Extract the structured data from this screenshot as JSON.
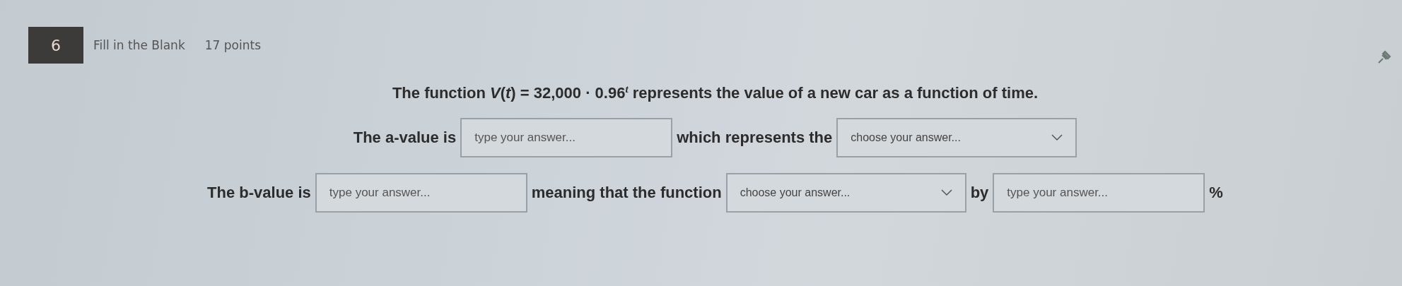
{
  "question": {
    "number": "6",
    "type": "Fill in the Blank",
    "points": "17 points"
  },
  "lines": [
    {
      "parts": [
        {
          "kind": "text",
          "text": "The function *V*(*t*) = 32,000 · 0.96$^{t}$ represents the value of a new car as a function of time."
        }
      ]
    },
    {
      "parts": [
        {
          "kind": "text",
          "text": "The a-value is"
        },
        {
          "kind": "input",
          "placeholder": "type your answer..."
        },
        {
          "kind": "text",
          "text": "which represents the"
        },
        {
          "kind": "dropdown",
          "placeholder": "choose your answer..."
        }
      ]
    },
    {
      "parts": [
        {
          "kind": "text",
          "text": "The b-value is"
        },
        {
          "kind": "input",
          "placeholder": "type your answer..."
        },
        {
          "kind": "text",
          "text": "meaning that the function"
        },
        {
          "kind": "dropdown",
          "placeholder": "choose your answer..."
        },
        {
          "kind": "text",
          "text": "by"
        },
        {
          "kind": "input",
          "placeholder": "type your answer..."
        },
        {
          "kind": "text",
          "text": "%"
        }
      ]
    }
  ]
}
